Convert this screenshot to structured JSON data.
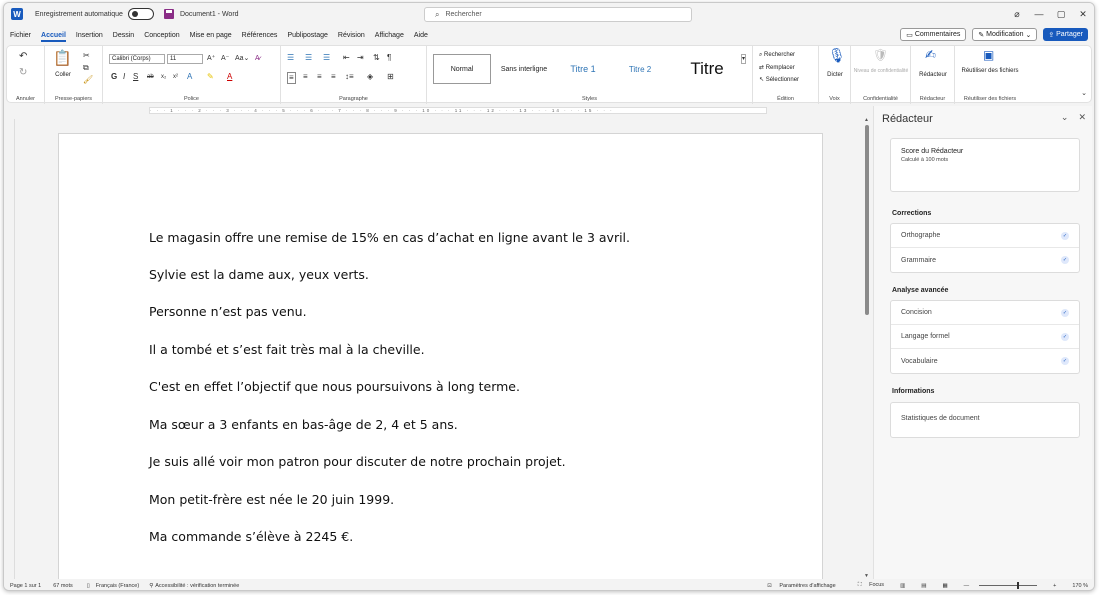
{
  "titlebar": {
    "app_icon": "word-icon",
    "app_letter": "W",
    "autosave_label": "Enregistrement automatique",
    "autosave_state": "off",
    "doc_title": "Document1 - Word",
    "search_placeholder": "Rechercher",
    "window_buttons": [
      "⌀",
      "—",
      "▢",
      "✕"
    ]
  },
  "menu": {
    "tabs": [
      "Fichier",
      "Accueil",
      "Insertion",
      "Dessin",
      "Conception",
      "Mise en page",
      "Références",
      "Publipostage",
      "Révision",
      "Affichage",
      "Aide"
    ],
    "active_tab": "Accueil",
    "comments_label": "Commentaires",
    "editing_label": "Modification",
    "share_label": "Partager"
  },
  "ribbon": {
    "groups": {
      "annuler": "Annuler",
      "presse_papiers": "Presse-papiers",
      "police": "Police",
      "paragraphe": "Paragraphe",
      "styles": "Styles",
      "edition": "Édition",
      "voix": "Voix",
      "confidentialite": "Confidentialité",
      "redacteur": "Rédacteur",
      "reutiliser": "Réutiliser des fichiers"
    },
    "coller_label": "Coller",
    "font_name": "Calibri (Corps)",
    "font_size": "11",
    "styles": [
      "Normal",
      "Sans interligne",
      "Titre 1",
      "Titre 2",
      "Titre"
    ],
    "rechercher": "Rechercher",
    "remplacer": "Remplacer",
    "selectionner": "Sélectionner",
    "dicter": "Dicter",
    "niveau_conf": "Niveau de confidentialité",
    "redacteur_btn": "Rédacteur",
    "reutiliser_btn": "Réutiliser des fichiers"
  },
  "document": {
    "lines": [
      "Le magasin offre une remise de 15% en cas d’achat en ligne avant le 3 avril.",
      "Sylvie est la dame aux, yeux verts.",
      "Personne n’est pas venu.",
      "Il a tombé et s’est fait très mal à la cheville.",
      "C'est en effet l’objectif que nous poursuivons à long terme.",
      "Ma sœur a 3 enfants en bas-âge de 2, 4 et 5 ans.",
      "Je suis allé voir mon patron pour discuter de notre prochain projet.",
      "Mon petit-frère est née le 20 juin 1999.",
      "Ma commande s’élève à 2245 €."
    ]
  },
  "pane": {
    "title": "Rédacteur",
    "score_title": "Score du Rédacteur",
    "score_sub": "Calculé à 100 mots",
    "corrections_head": "Corrections",
    "corrections": [
      "Orthographe",
      "Grammaire"
    ],
    "analyse_head": "Analyse avancée",
    "analyse": [
      "Concision",
      "Langage formel",
      "Vocabulaire"
    ],
    "info_head": "Informations",
    "info_item": "Statistiques de document"
  },
  "status": {
    "page": "Page 1 sur 1",
    "words": "67 mots",
    "language": "Français (France)",
    "accessibility": "Accessibilité : vérification terminée",
    "display_settings": "Paramètres d'affichage",
    "focus": "Focus",
    "zoom": "170 %"
  }
}
